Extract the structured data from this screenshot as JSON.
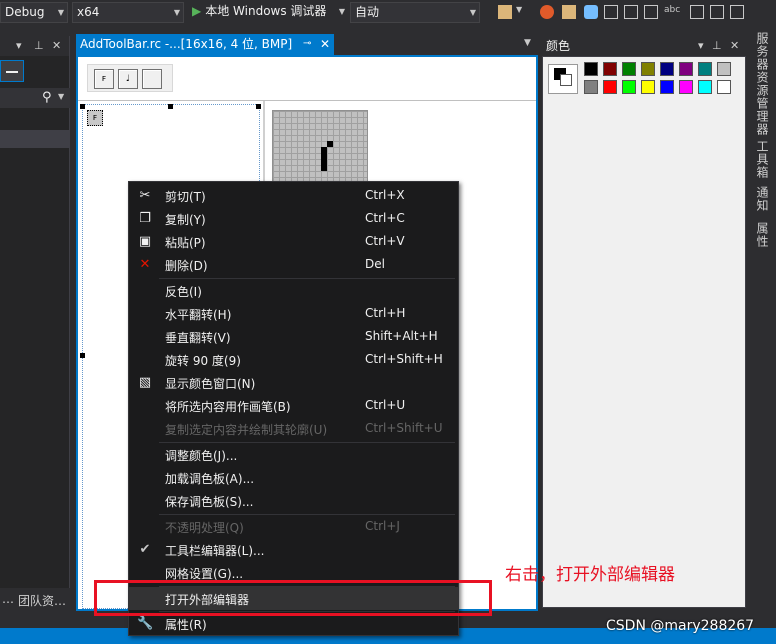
{
  "toolbar": {
    "config": "Debug",
    "platform": "x64",
    "run_label": "本地 Windows 调试器",
    "run_mode": "自动"
  },
  "left_panel": {
    "bottom_tabs": [
      "… ",
      "团队资…"
    ]
  },
  "document_tab": {
    "title": "AddToolBar.rc -...[16x16, 4 位, BMP]"
  },
  "colors_panel": {
    "title": "颜色",
    "swatches_row1": [
      "#000000",
      "#800000",
      "#008000",
      "#808000",
      "#000080",
      "#800080",
      "#008080",
      "#c0c0c0"
    ],
    "swatches_row2": [
      "#808080",
      "#ff0000",
      "#00ff00",
      "#ffff00",
      "#0000ff",
      "#ff00ff",
      "#00ffff",
      "#ffffff"
    ]
  },
  "right_tabs": [
    "服务器资源管理器",
    "工具箱",
    "通知",
    "属性"
  ],
  "context_menu": {
    "items": [
      {
        "label": "剪切(T)",
        "shortcut": "Ctrl+X",
        "icon": "scissors-icon",
        "disabled": false
      },
      {
        "label": "复制(Y)",
        "shortcut": "Ctrl+C",
        "icon": "copy-icon",
        "disabled": false
      },
      {
        "label": "粘贴(P)",
        "shortcut": "Ctrl+V",
        "icon": "paste-icon",
        "disabled": false
      },
      {
        "label": "删除(D)",
        "shortcut": "Del",
        "icon": "delete-icon",
        "disabled": false
      },
      {
        "label": "反色(I)",
        "shortcut": "",
        "icon": "",
        "disabled": false
      },
      {
        "label": "水平翻转(H)",
        "shortcut": "Ctrl+H",
        "icon": "",
        "disabled": false
      },
      {
        "label": "垂直翻转(V)",
        "shortcut": "Shift+Alt+H",
        "icon": "",
        "disabled": false
      },
      {
        "label": "旋转 90 度(9)",
        "shortcut": "Ctrl+Shift+H",
        "icon": "",
        "disabled": false
      },
      {
        "label": "显示颜色窗口(N)",
        "shortcut": "",
        "icon": "color-window-icon",
        "disabled": false
      },
      {
        "label": "将所选内容用作画笔(B)",
        "shortcut": "Ctrl+U",
        "icon": "",
        "disabled": false
      },
      {
        "label": "复制选定内容并绘制其轮廓(U)",
        "shortcut": "Ctrl+Shift+U",
        "icon": "",
        "disabled": true
      },
      {
        "label": "调整颜色(J)...",
        "shortcut": "",
        "icon": "",
        "disabled": false
      },
      {
        "label": "加载调色板(A)...",
        "shortcut": "",
        "icon": "",
        "disabled": false
      },
      {
        "label": "保存调色板(S)...",
        "shortcut": "",
        "icon": "",
        "disabled": false
      },
      {
        "label": "不透明处理(Q)",
        "shortcut": "Ctrl+J",
        "icon": "",
        "disabled": true
      },
      {
        "label": "工具栏编辑器(L)...",
        "shortcut": "",
        "icon": "check-icon",
        "disabled": false
      },
      {
        "label": "网格设置(G)...",
        "shortcut": "",
        "icon": "",
        "disabled": false
      },
      {
        "label": "打开外部编辑器",
        "shortcut": "",
        "icon": "",
        "disabled": false
      },
      {
        "label": "属性(R)",
        "shortcut": "",
        "icon": "wrench-icon",
        "disabled": false
      }
    ]
  },
  "annotation": "右击，打开外部编辑器",
  "watermark": "CSDN @mary288267"
}
